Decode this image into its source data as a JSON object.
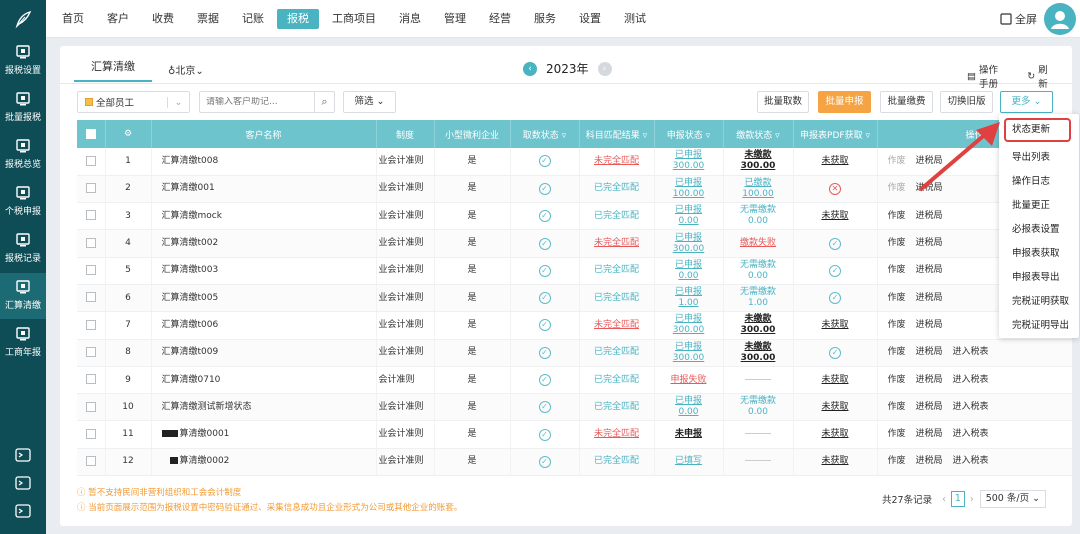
{
  "nav": {
    "items": [
      "首页",
      "客户",
      "收费",
      "票据",
      "记账",
      "报税",
      "工商项目",
      "消息",
      "管理",
      "经营",
      "服务",
      "设置",
      "测试"
    ],
    "active": "报税",
    "fullscreen_label": "全屏"
  },
  "sidebar": {
    "items": [
      {
        "label": "报税设置",
        "icon": "monitor-settings-icon"
      },
      {
        "label": "批量报税",
        "icon": "monitor-download-icon"
      },
      {
        "label": "报税总览",
        "icon": "overview-icon"
      },
      {
        "label": "个税申报",
        "icon": "person-dollar-icon"
      },
      {
        "label": "报税记录",
        "icon": "tax-record-icon"
      },
      {
        "label": "汇算清缴",
        "icon": "calc-icon",
        "active": true
      },
      {
        "label": "工商年报",
        "icon": "calendar-icon"
      }
    ],
    "bottom_icons": [
      "terminal-icon",
      "download-icon",
      "headset-icon"
    ]
  },
  "tab": {
    "label": "汇算清缴"
  },
  "region": "北京",
  "year": "2023年",
  "links": {
    "manual": "操作手册",
    "refresh": "刷新"
  },
  "toolbar": {
    "employee_select": "全部员工",
    "search_placeholder": "请输入客户助记...",
    "filter_label": "筛选",
    "buttons": {
      "batch_fetch": "批量取数",
      "batch_declare": "批量申报",
      "batch_pay": "批量缴费",
      "switch_old": "切换旧版",
      "more": "更多"
    }
  },
  "table": {
    "headers": [
      "",
      "",
      "客户名称",
      "制度",
      "小型微利企业",
      "取数状态",
      "科目匹配结果",
      "申报状态",
      "缴款状态",
      "申报表PDF获取",
      "操作"
    ],
    "rows": [
      {
        "no": "1",
        "name": "汇算清缴t008",
        "system": "业会计准则",
        "small": "是",
        "fetch": "ok",
        "match": "未完全匹配",
        "match_type": "red",
        "declare": [
          "已申报",
          "300.00"
        ],
        "declare_type": "teal",
        "pay": [
          "未缴款",
          "300.00"
        ],
        "pay_type": "black",
        "pdf": "未获取",
        "pdf_type": "text",
        "ops": [
          "作废",
          "进税局"
        ]
      },
      {
        "no": "2",
        "name": "汇算清缴001",
        "system": "业会计准则",
        "small": "是",
        "fetch": "ok",
        "match": "已完全匹配",
        "match_type": "teal",
        "declare": [
          "已申报",
          "100.00"
        ],
        "declare_type": "teal",
        "pay": [
          "已缴款",
          "100.00"
        ],
        "pay_type": "teal",
        "pdf": "",
        "pdf_type": "err",
        "ops": [
          "作废",
          "进税局"
        ]
      },
      {
        "no": "3",
        "name": "汇算清缴mock",
        "system": "业会计准则",
        "small": "是",
        "fetch": "ok",
        "match": "已完全匹配",
        "match_type": "teal",
        "declare": [
          "已申报",
          "0.00"
        ],
        "declare_type": "teal",
        "pay": [
          "无需缴款",
          "0.00"
        ],
        "pay_type": "tealplain",
        "pdf": "未获取",
        "pdf_type": "text",
        "ops": [
          "作废",
          "进税局"
        ]
      },
      {
        "no": "4",
        "name": "汇算清缴t002",
        "system": "业会计准则",
        "small": "是",
        "fetch": "ok",
        "match": "未完全匹配",
        "match_type": "red",
        "declare": [
          "已申报",
          "300.00"
        ],
        "declare_type": "teal",
        "pay": [
          "缴款失败",
          ""
        ],
        "pay_type": "red",
        "pdf": "",
        "pdf_type": "ok",
        "ops": [
          "作废",
          "进税局"
        ]
      },
      {
        "no": "5",
        "name": "汇算清缴t003",
        "system": "业会计准则",
        "small": "是",
        "fetch": "ok",
        "match": "已完全匹配",
        "match_type": "teal",
        "declare": [
          "已申报",
          "0.00"
        ],
        "declare_type": "teal",
        "pay": [
          "无需缴款",
          "0.00"
        ],
        "pay_type": "tealplain",
        "pdf": "",
        "pdf_type": "ok",
        "ops": [
          "作废",
          "进税局"
        ]
      },
      {
        "no": "6",
        "name": "汇算清缴t005",
        "system": "业会计准则",
        "small": "是",
        "fetch": "ok",
        "match": "已完全匹配",
        "match_type": "teal",
        "declare": [
          "已申报",
          "1.00"
        ],
        "declare_type": "teal",
        "pay": [
          "无需缴款",
          "1.00"
        ],
        "pay_type": "tealplain",
        "pdf": "",
        "pdf_type": "ok",
        "ops": [
          "作废",
          "进税局"
        ]
      },
      {
        "no": "7",
        "name": "汇算清缴t006",
        "system": "业会计准则",
        "small": "是",
        "fetch": "ok",
        "match": "未完全匹配",
        "match_type": "red",
        "declare": [
          "已申报",
          "300.00"
        ],
        "declare_type": "teal",
        "pay": [
          "未缴款",
          "300.00"
        ],
        "pay_type": "black",
        "pdf": "未获取",
        "pdf_type": "text",
        "ops": [
          "作废",
          "进税局"
        ]
      },
      {
        "no": "8",
        "name": "汇算清缴t009",
        "system": "业会计准则",
        "small": "是",
        "fetch": "ok",
        "match": "已完全匹配",
        "match_type": "teal",
        "declare": [
          "已申报",
          "300.00"
        ],
        "declare_type": "teal",
        "pay": [
          "未缴款",
          "300.00"
        ],
        "pay_type": "black",
        "pdf": "",
        "pdf_type": "ok",
        "ops": [
          "作废",
          "进税局",
          "进入税表"
        ]
      },
      {
        "no": "9",
        "name": "汇算清缴0710",
        "system": "会计准则",
        "small": "是",
        "fetch": "ok",
        "match": "已完全匹配",
        "match_type": "teal",
        "declare": [
          "申报失败",
          ""
        ],
        "declare_type": "red",
        "pay": [
          "",
          ""
        ],
        "pay_type": "dash",
        "pdf": "未获取",
        "pdf_type": "text",
        "ops": [
          "作废",
          "进税局",
          "进入税表"
        ]
      },
      {
        "no": "10",
        "name": "汇算清缴测试新增状态",
        "system": "业会计准则",
        "small": "是",
        "fetch": "ok",
        "match": "已完全匹配",
        "match_type": "teal",
        "declare": [
          "已申报",
          "0.00"
        ],
        "declare_type": "teal",
        "pay": [
          "无需缴款",
          "0.00"
        ],
        "pay_type": "tealplain",
        "pdf": "未获取",
        "pdf_type": "text",
        "ops": [
          "作废",
          "进税局",
          "进入税表"
        ]
      },
      {
        "no": "11",
        "name": "算清缴0001",
        "system": "业会计准则",
        "small": "是",
        "fetch": "ok",
        "match": "未完全匹配",
        "match_type": "red",
        "declare": [
          "未申报",
          ""
        ],
        "declare_type": "black",
        "pay": [
          "",
          ""
        ],
        "pay_type": "dash",
        "pdf": "未获取",
        "pdf_type": "text",
        "ops": [
          "作废",
          "进税局",
          "进入税表"
        ],
        "redacted": true
      },
      {
        "no": "12",
        "name": "算清缴0002",
        "system": "业会计准则",
        "small": "是",
        "fetch": "ok",
        "match": "已完全匹配",
        "match_type": "teal",
        "declare": [
          "已填写",
          ""
        ],
        "declare_type": "teal",
        "pay": [
          "",
          ""
        ],
        "pay_type": "dash",
        "pdf": "未获取",
        "pdf_type": "text",
        "ops": [
          "作废",
          "进税局",
          "进入税表"
        ],
        "redacted": true
      }
    ]
  },
  "notes": [
    "暂不支持民间非营利组织和工会会计制度",
    "当前页面展示范围为报税设置中密码验证通过、采集信息成功且企业形式为公司或其他企业的账套。"
  ],
  "pagination": {
    "total": "共27条记录",
    "page": "1",
    "page_size": "500 条/页"
  },
  "more_menu": {
    "items": [
      "状态更新",
      "导出列表",
      "操作日志",
      "批量更正",
      "必报表设置",
      "申报表获取",
      "申报表导出",
      "完税证明获取",
      "完税证明导出"
    ],
    "highlighted": "状态更新"
  },
  "colors": {
    "sidebar": "#0f4d56",
    "accent": "#49b3c2",
    "header": "#6ec4cd",
    "primary_button": "#f5a343",
    "error": "#e85a5a",
    "note": "#f39a34"
  }
}
